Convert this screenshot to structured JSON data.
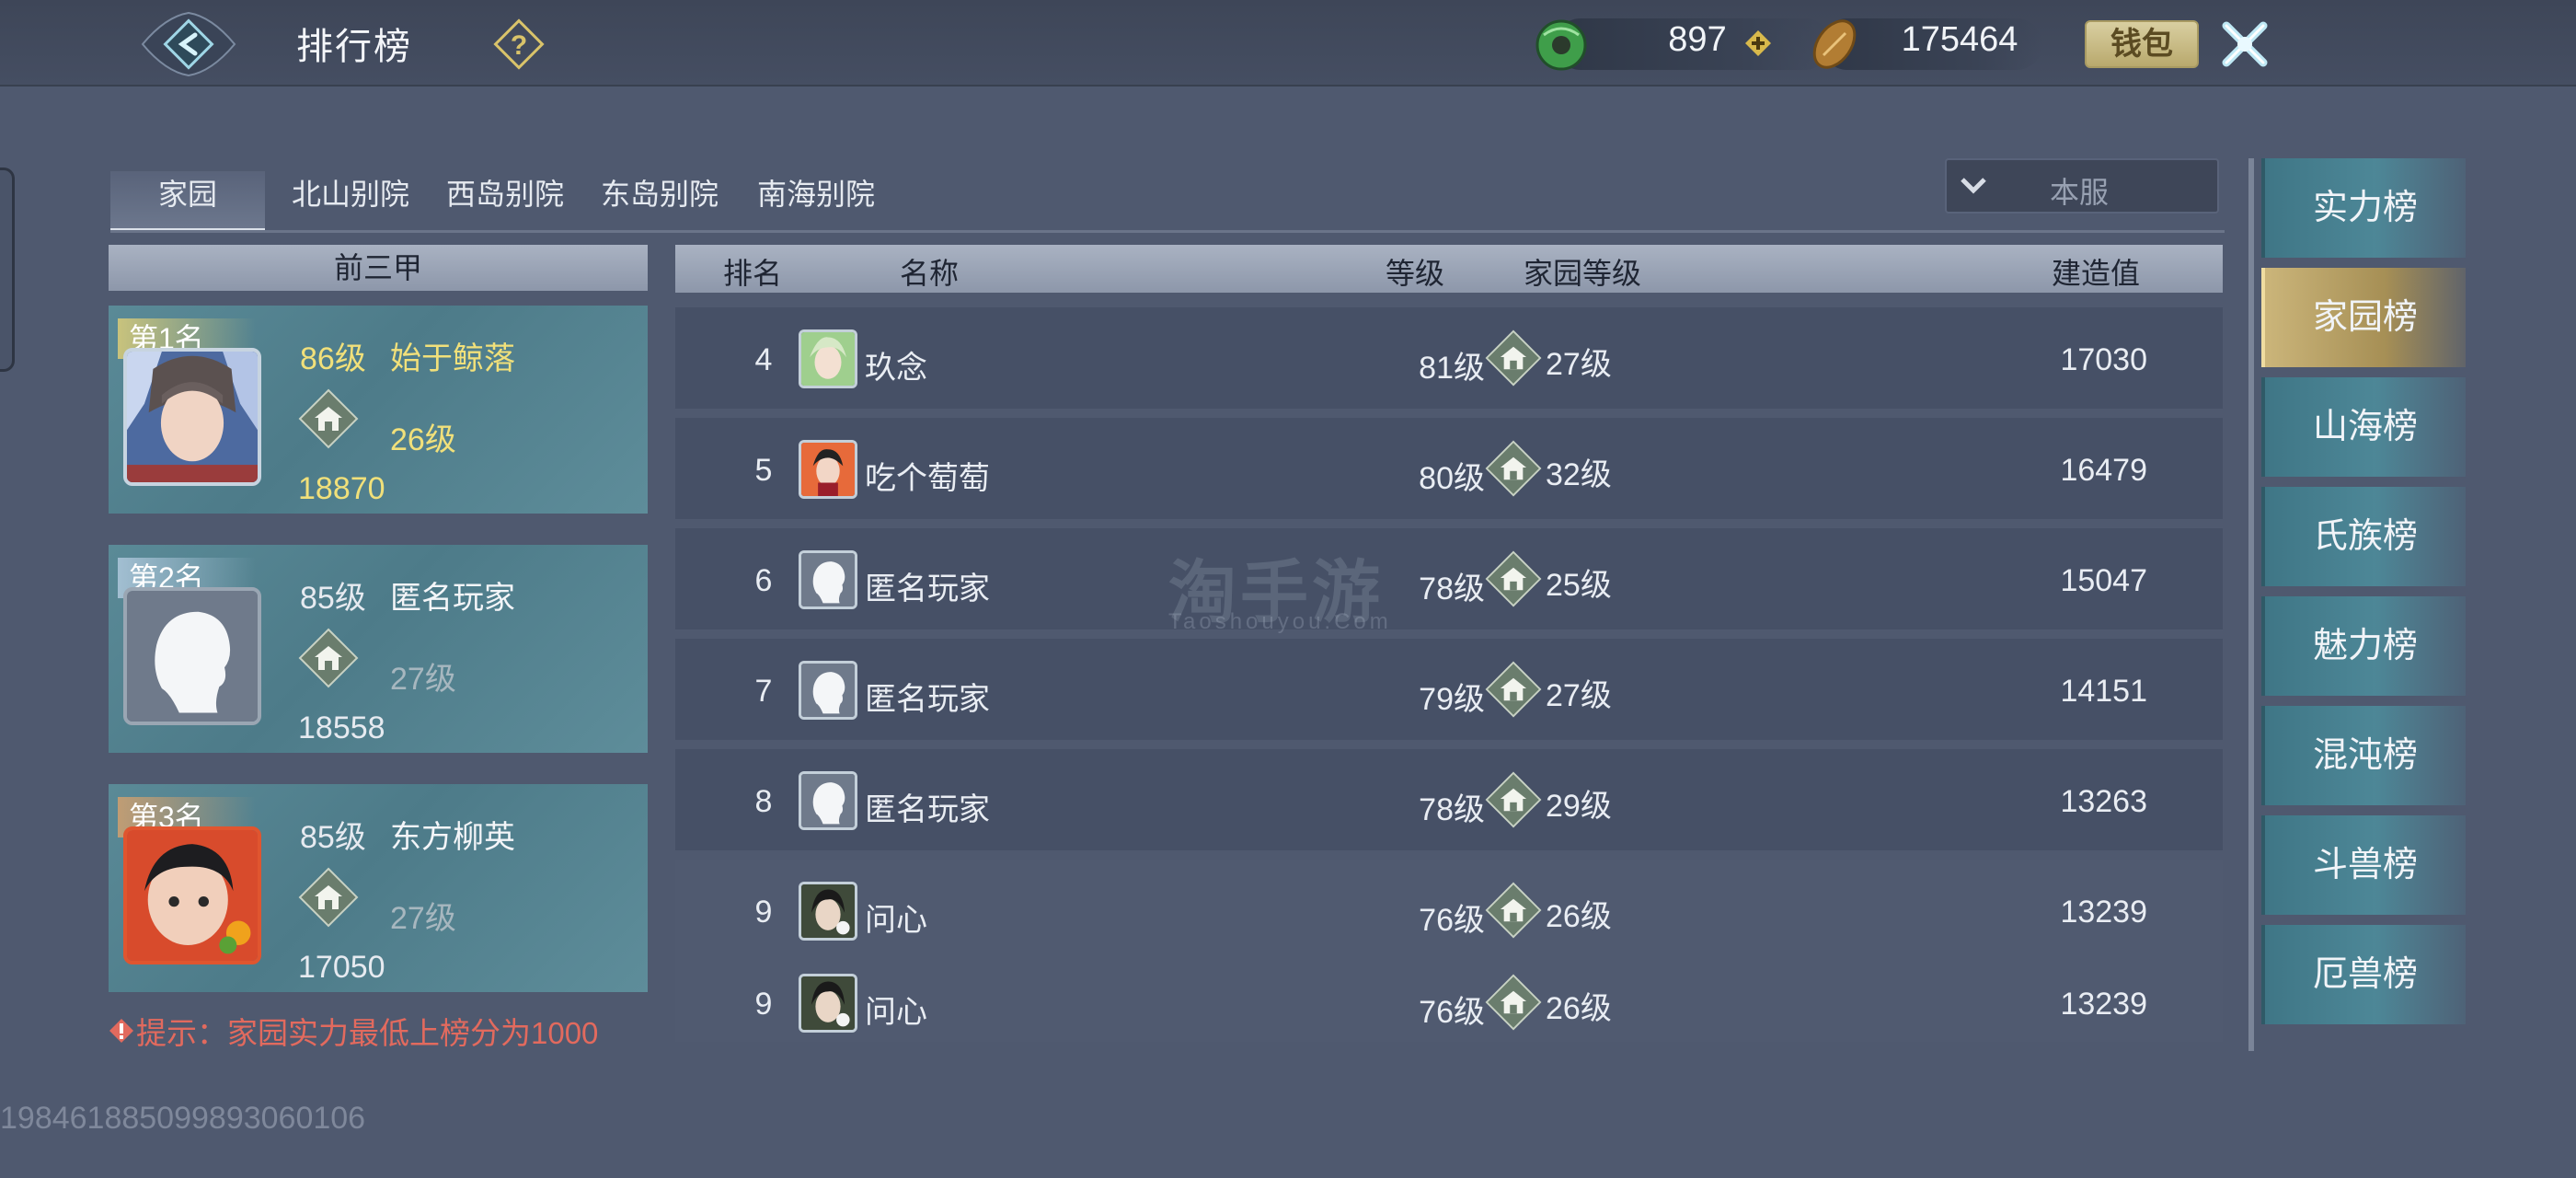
{
  "header": {
    "title": "排行榜",
    "help_icon": "question-icon",
    "jade": "897",
    "coins": "175464",
    "wallet_label": "钱包",
    "close_icon": "close-icon"
  },
  "tabs": [
    "家园",
    "北山别院",
    "西岛别院",
    "东岛别院",
    "南海别院"
  ],
  "active_tab": "家园",
  "server_filter": "本服",
  "top3": {
    "header": "前三甲",
    "entries": [
      {
        "rank_label": "第1名",
        "level": "86级",
        "name": "始于鲸落",
        "home_level": "26级",
        "score": "18870"
      },
      {
        "rank_label": "第2名",
        "level": "85级",
        "name": "匿名玩家",
        "home_level": "27级",
        "score": "18558"
      },
      {
        "rank_label": "第3名",
        "level": "85级",
        "name": "东方柳英",
        "home_level": "27级",
        "score": "17050"
      }
    ]
  },
  "tip": "提示：家园实力最低上榜分为1000",
  "uid": "19846188509989306010​6",
  "table": {
    "columns": [
      "排名",
      "名称",
      "等级",
      "家园等级",
      "建造值"
    ],
    "rows": [
      {
        "rank": "4",
        "name": "玖念",
        "level": "81级",
        "home_level": "27级",
        "score": "17030",
        "avatar": "green"
      },
      {
        "rank": "5",
        "name": "吃个萄萄",
        "level": "80级",
        "home_level": "32级",
        "score": "16479",
        "avatar": "orange"
      },
      {
        "rank": "6",
        "name": "匿名玩家",
        "level": "78级",
        "home_level": "25级",
        "score": "15047",
        "avatar": "anon"
      },
      {
        "rank": "7",
        "name": "匿名玩家",
        "level": "79级",
        "home_level": "27级",
        "score": "14151",
        "avatar": "anon"
      },
      {
        "rank": "8",
        "name": "匿名玩家",
        "level": "78级",
        "home_level": "29级",
        "score": "13263",
        "avatar": "anon"
      },
      {
        "rank": "9",
        "name": "问心",
        "level": "76级",
        "home_level": "26级",
        "score": "13239",
        "avatar": "dark"
      },
      {
        "rank": "9",
        "name": "问心",
        "level": "76级",
        "home_level": "26级",
        "score": "13239",
        "avatar": "dark"
      }
    ]
  },
  "watermark": {
    "main": "淘手游",
    "sub": "Taoshouyou.Com"
  },
  "right_menu": {
    "items": [
      "实力榜",
      "家园榜",
      "山海榜",
      "氏族榜",
      "魅力榜",
      "混沌榜",
      "斗兽榜",
      "厄兽榜"
    ],
    "active": "家园榜"
  },
  "colors": {
    "gold": "#f1e07a",
    "tip": "#e26a5e",
    "active_menu": "#cbb57a"
  }
}
